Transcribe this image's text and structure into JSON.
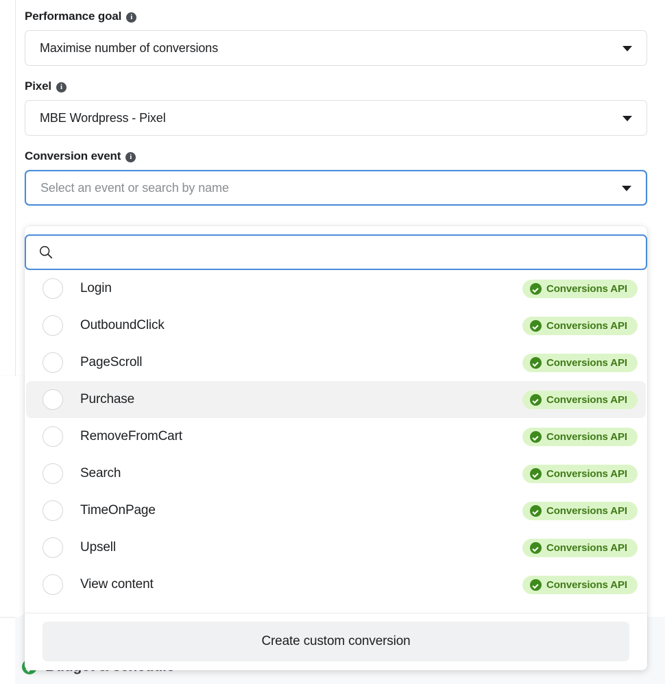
{
  "background": {
    "section_title": "Budget & schedule",
    "section_status_icon": "green-check-circle-icon"
  },
  "form": {
    "fields": [
      {
        "label": "Performance goal",
        "info_icon": "info-icon",
        "value": "Maximise number of conversions",
        "caret_icon": "chevron-down-icon",
        "focused": false,
        "is_placeholder": false
      },
      {
        "label": "Pixel",
        "info_icon": "info-icon",
        "value": "MBE Wordpress - Pixel",
        "caret_icon": "chevron-down-icon",
        "focused": false,
        "is_placeholder": false
      },
      {
        "label": "Conversion event",
        "info_icon": "info-icon",
        "value": "Select an event or search by name",
        "caret_icon": "chevron-down-icon",
        "focused": true,
        "is_placeholder": true
      }
    ]
  },
  "dropdown": {
    "search": {
      "icon": "search-icon",
      "value": "",
      "placeholder": ""
    },
    "badge": {
      "label": "Conversions API",
      "icon": "check-circle-icon",
      "bg_color": "#dcf5c8",
      "text_color": "#3f7a18",
      "icon_color": "#3f8a1d"
    },
    "options": [
      {
        "label": "Login",
        "selected": false,
        "hovered": false,
        "badge": "Conversions API"
      },
      {
        "label": "OutboundClick",
        "selected": false,
        "hovered": false,
        "badge": "Conversions API"
      },
      {
        "label": "PageScroll",
        "selected": false,
        "hovered": false,
        "badge": "Conversions API"
      },
      {
        "label": "Purchase",
        "selected": false,
        "hovered": true,
        "badge": "Conversions API"
      },
      {
        "label": "RemoveFromCart",
        "selected": false,
        "hovered": false,
        "badge": "Conversions API"
      },
      {
        "label": "Search",
        "selected": false,
        "hovered": false,
        "badge": "Conversions API"
      },
      {
        "label": "TimeOnPage",
        "selected": false,
        "hovered": false,
        "badge": "Conversions API"
      },
      {
        "label": "Upsell",
        "selected": false,
        "hovered": false,
        "badge": "Conversions API"
      },
      {
        "label": "View content",
        "selected": false,
        "hovered": false,
        "badge": "Conversions API"
      }
    ],
    "footer": {
      "create_label": "Create custom conversion"
    }
  },
  "colors": {
    "focus_border": "#4a8cd8",
    "hover_row": "#f2f2f2",
    "text_primary": "#1c1e21",
    "text_placeholder": "#8a8d91",
    "border": "#dddfe2",
    "footer_button_bg": "#f0f1f3",
    "status_green": "#31a24c"
  }
}
